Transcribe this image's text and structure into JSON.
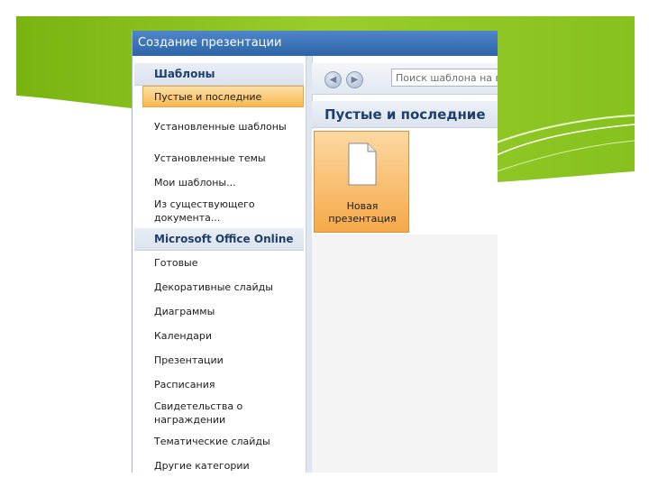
{
  "dialog": {
    "title": "Создание презентации"
  },
  "left_pane": {
    "section_templates": "Шаблоны",
    "items": [
      "Пустые и последние",
      "Установленные шаблоны",
      "Установленные темы",
      "Мои шаблоны...",
      "Из существующего документа..."
    ],
    "section_online": "Microsoft Office Online",
    "online_items": [
      "Готовые",
      "Декоративные слайды",
      "Диаграммы",
      "Календари",
      "Презентации",
      "Расписания",
      "Свидетельства о награждении",
      "Тематические слайды",
      "Другие категории"
    ]
  },
  "toolbar": {
    "search_placeholder": "Поиск шаблона на веб-узле Microsoft Office Online"
  },
  "right_pane": {
    "header": "Пустые и последние",
    "tile_label": "Новая презентация"
  },
  "colors": {
    "accent_green": "#8ec21f",
    "title_blue": "#3a72b8",
    "selection_orange": "#f8b74f"
  },
  "icons": {
    "back": "arrow-left-icon",
    "forward": "arrow-right-icon",
    "document": "blank-document-icon"
  }
}
